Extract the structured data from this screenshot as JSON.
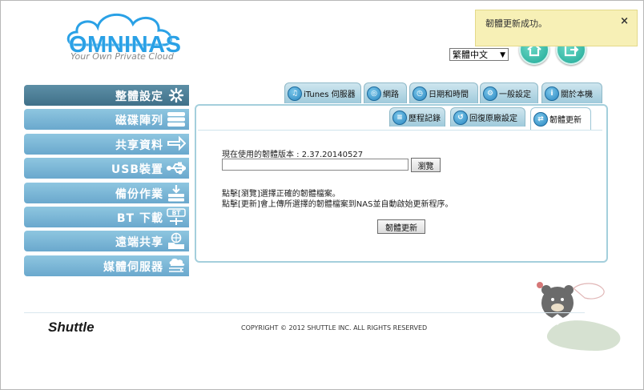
{
  "brand": {
    "logo_text": "OMNINAS",
    "tagline": "Your Own Private Cloud",
    "accent": "#2aa1e6"
  },
  "language": {
    "selected": "繁體中文"
  },
  "notification": {
    "message": "韌體更新成功。",
    "close": "×"
  },
  "top_buttons": [
    {
      "icon": "home-icon"
    },
    {
      "icon": "logout-icon"
    }
  ],
  "sidebar": {
    "items": [
      {
        "label": "整體設定",
        "icon": "settings-icon",
        "active": true
      },
      {
        "label": "磁碟陣列",
        "icon": "disk-array-icon"
      },
      {
        "label": "共享資料",
        "icon": "share-arrow-icon"
      },
      {
        "label": "USB裝置",
        "icon": "usb-icon"
      },
      {
        "label": "備份作業",
        "icon": "backup-icon"
      },
      {
        "label": "BT 下載",
        "icon": "bt-download-icon",
        "badge": "BT"
      },
      {
        "label": "遠端共享",
        "icon": "remote-share-icon"
      },
      {
        "label": "媒體伺服器",
        "icon": "media-server-icon"
      }
    ]
  },
  "tabs": {
    "top": [
      {
        "label": "iTunes 伺服器",
        "icon": "music-note-icon"
      },
      {
        "label": "網路",
        "icon": "network-icon"
      },
      {
        "label": "日期和時間",
        "icon": "clock-icon"
      },
      {
        "label": "一般設定",
        "icon": "general-settings-icon"
      },
      {
        "label": "關於本機",
        "icon": "info-icon"
      }
    ],
    "sub": [
      {
        "label": "歷程記錄",
        "icon": "log-icon"
      },
      {
        "label": "回復原廠設定",
        "icon": "restore-icon"
      },
      {
        "label": "韌體更新",
        "icon": "firmware-icon",
        "active": true
      }
    ]
  },
  "firmware": {
    "current_version_label": "現在使用的韌體版本 : 2.37.20140527",
    "browse_label": "瀏覽",
    "hint_line1": "點擊[瀏覽]選擇正確的韌體檔案。",
    "hint_line2": "點擊[更新]會上傳所選擇的韌體檔案到NAS並自動啟始更新程序。",
    "update_button": "韌體更新"
  },
  "footer": {
    "brand": "Shuttle",
    "copyright": "COPYRIGHT © 2012 SHUTTLE INC. ALL RIGHTS RESERVED"
  }
}
